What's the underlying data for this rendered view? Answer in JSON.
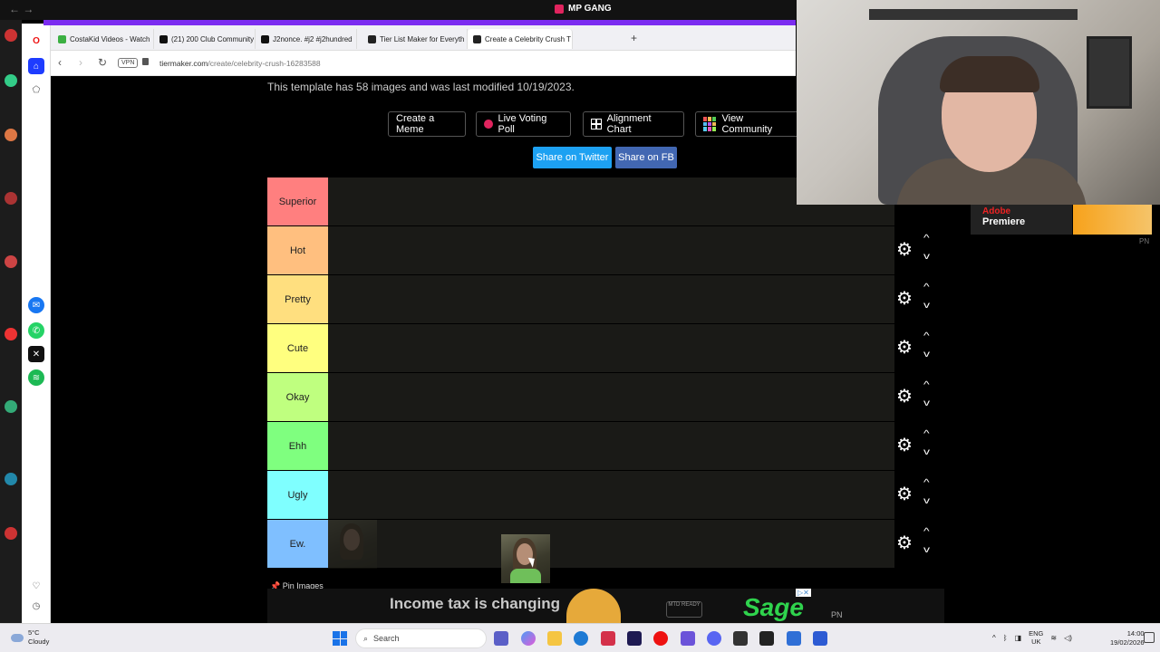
{
  "window": {
    "title": "MP GANG",
    "nav_arrows": "← →"
  },
  "tabs": [
    {
      "label": "CostaKid Videos - Watch",
      "color": "#3cb043"
    },
    {
      "label": "(21) 200 Club Community",
      "color": "#111111"
    },
    {
      "label": "J2nonce. #j2 #j2hundred",
      "color": "#111111"
    },
    {
      "label": "Tier List Maker for Everyth",
      "color": "#222222"
    },
    {
      "label": "Create a Celebrity Crush T",
      "color": "#222222",
      "active": true
    }
  ],
  "new_tab_label": "+",
  "address": {
    "vpn_label": "VPN",
    "url_host": "tiermaker.com",
    "url_path": "/create/celebrity-crush-16283588"
  },
  "page": {
    "template_info": "This template has 58 images and was last modified 10/19/2023.",
    "buttons": {
      "meme": "Create a Meme",
      "poll": "Live Voting Poll",
      "alignment": "Alignment Chart",
      "community": "View Community"
    },
    "share": {
      "twitter": "Share on Twitter",
      "fb": "Share on FB"
    },
    "tiers": [
      {
        "label": "Superior",
        "color": "#ff7f7f"
      },
      {
        "label": "Hot",
        "color": "#ffbf7f"
      },
      {
        "label": "Pretty",
        "color": "#ffdf7f"
      },
      {
        "label": "Cute",
        "color": "#ffff7f"
      },
      {
        "label": "Okay",
        "color": "#bfff7f"
      },
      {
        "label": "Ehh",
        "color": "#7fff7f"
      },
      {
        "label": "Ugly",
        "color": "#7fffff"
      },
      {
        "label": "Ew.",
        "color": "#7fbfff"
      }
    ],
    "pin_images": "Pin Images"
  },
  "ad": {
    "headline": "Income tax is changing",
    "brand": "Sage",
    "badge": "MTD READY",
    "pn": "PN"
  },
  "stream_overlay": {
    "adobe": "Adobe",
    "premiere": "Premiere",
    "pn": "PN"
  },
  "taskbar": {
    "temperature": "5°C",
    "condition": "Cloudy",
    "search_placeholder": "Search",
    "lang_top": "ENG",
    "lang_bottom": "UK",
    "time": "14:00",
    "date": "19/02/2026"
  }
}
